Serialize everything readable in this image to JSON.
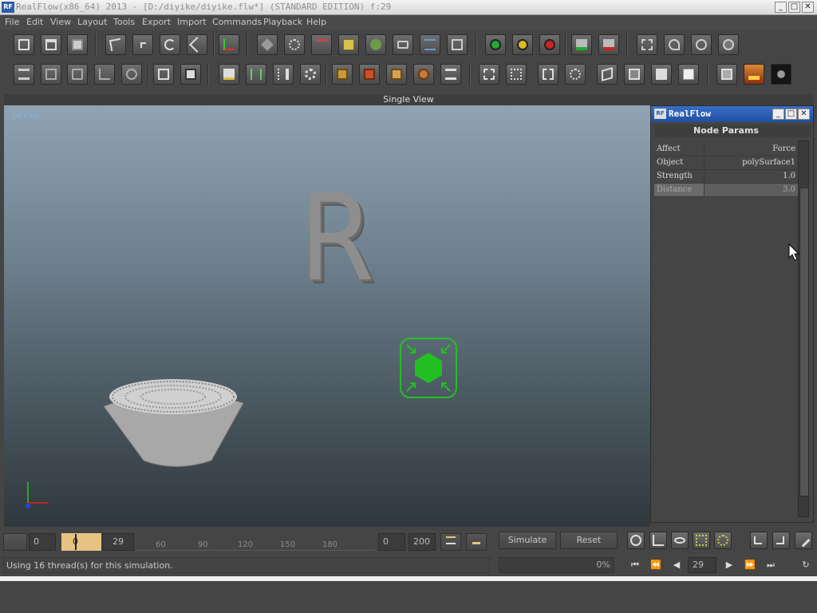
{
  "app": {
    "title": "RealFlow(x86_64) 2013 - [D:/diyike/diyike.flw*] (STANDARD EDITION) f:29",
    "logo_text": "RF"
  },
  "window_controls": {
    "minimize": "_",
    "maximize": "□",
    "close": "✕"
  },
  "menu": [
    "File",
    "Edit",
    "View",
    "Layout",
    "Tools",
    "Export",
    "Import",
    "Commands",
    "Playback",
    "Help"
  ],
  "viewport": {
    "header": "Single View",
    "camera": "persp",
    "text_object": "R"
  },
  "panel": {
    "title": "RealFlow",
    "logo_text": "RF",
    "section_title": "Node Params",
    "params": [
      {
        "key": "Affect",
        "value": "Force"
      },
      {
        "key": "Object",
        "value": "polySurface1"
      },
      {
        "key": "Strength",
        "value": "1.0"
      },
      {
        "key": "Distance",
        "value": "3.0"
      }
    ]
  },
  "timeline": {
    "start": "0",
    "current_left": "0",
    "current_right": "29",
    "ticks": [
      "60",
      "90",
      "120",
      "150",
      "180"
    ],
    "range_start": "0",
    "range_end": "200",
    "simulate_label": "Simulate",
    "reset_label": "Reset"
  },
  "status": {
    "message": "Using 16 thread(s) for this simulation.",
    "progress": "0%",
    "frame": "29"
  },
  "colors": {
    "accent": "#2d5fa8",
    "daemon_green": "#22c022",
    "timeline_highlight": "#e7c383"
  }
}
